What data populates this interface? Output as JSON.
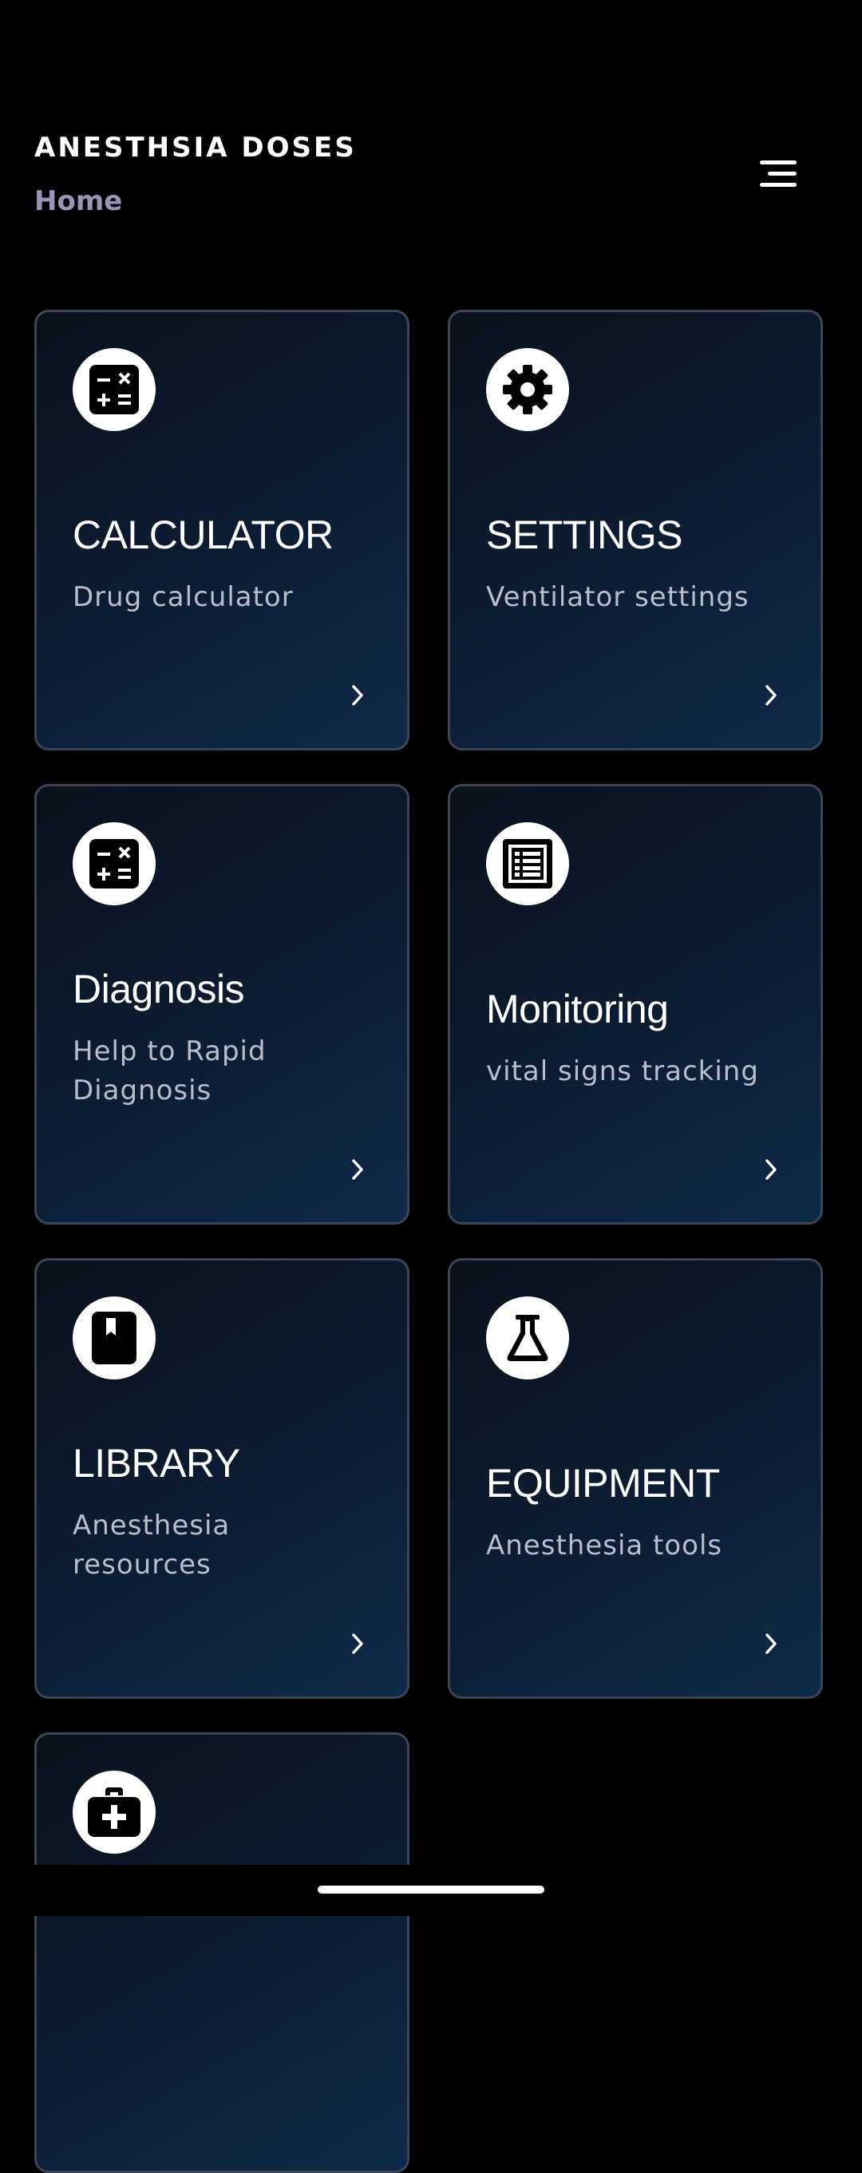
{
  "header": {
    "app_title": "ANESTHSIA DOSES",
    "breadcrumb": "Home",
    "menu_icon": "hamburger-menu-icon"
  },
  "cards": [
    {
      "title": "CALCULATOR",
      "subtitle": "Drug calculator",
      "icon": "calculator-icon"
    },
    {
      "title": "SETTINGS",
      "subtitle": "Ventilator settings",
      "icon": "gear-icon"
    },
    {
      "title": "Diagnosis",
      "subtitle": "Help to Rapid Diagnosis",
      "icon": "calculator-icon"
    },
    {
      "title": "Monitoring",
      "subtitle": "vital signs tracking",
      "icon": "list-icon"
    },
    {
      "title": "LIBRARY",
      "subtitle": "Anesthesia resources",
      "icon": "book-icon"
    },
    {
      "title": "EQUIPMENT",
      "subtitle": "Anesthesia tools",
      "icon": "flask-icon"
    },
    {
      "title": "",
      "subtitle": "",
      "icon": "medical-kit-icon"
    }
  ],
  "colors": {
    "background": "#000000",
    "card_border": "#3a4556",
    "breadcrumb": "#9b93b8",
    "subtitle": "#b8bfca"
  }
}
